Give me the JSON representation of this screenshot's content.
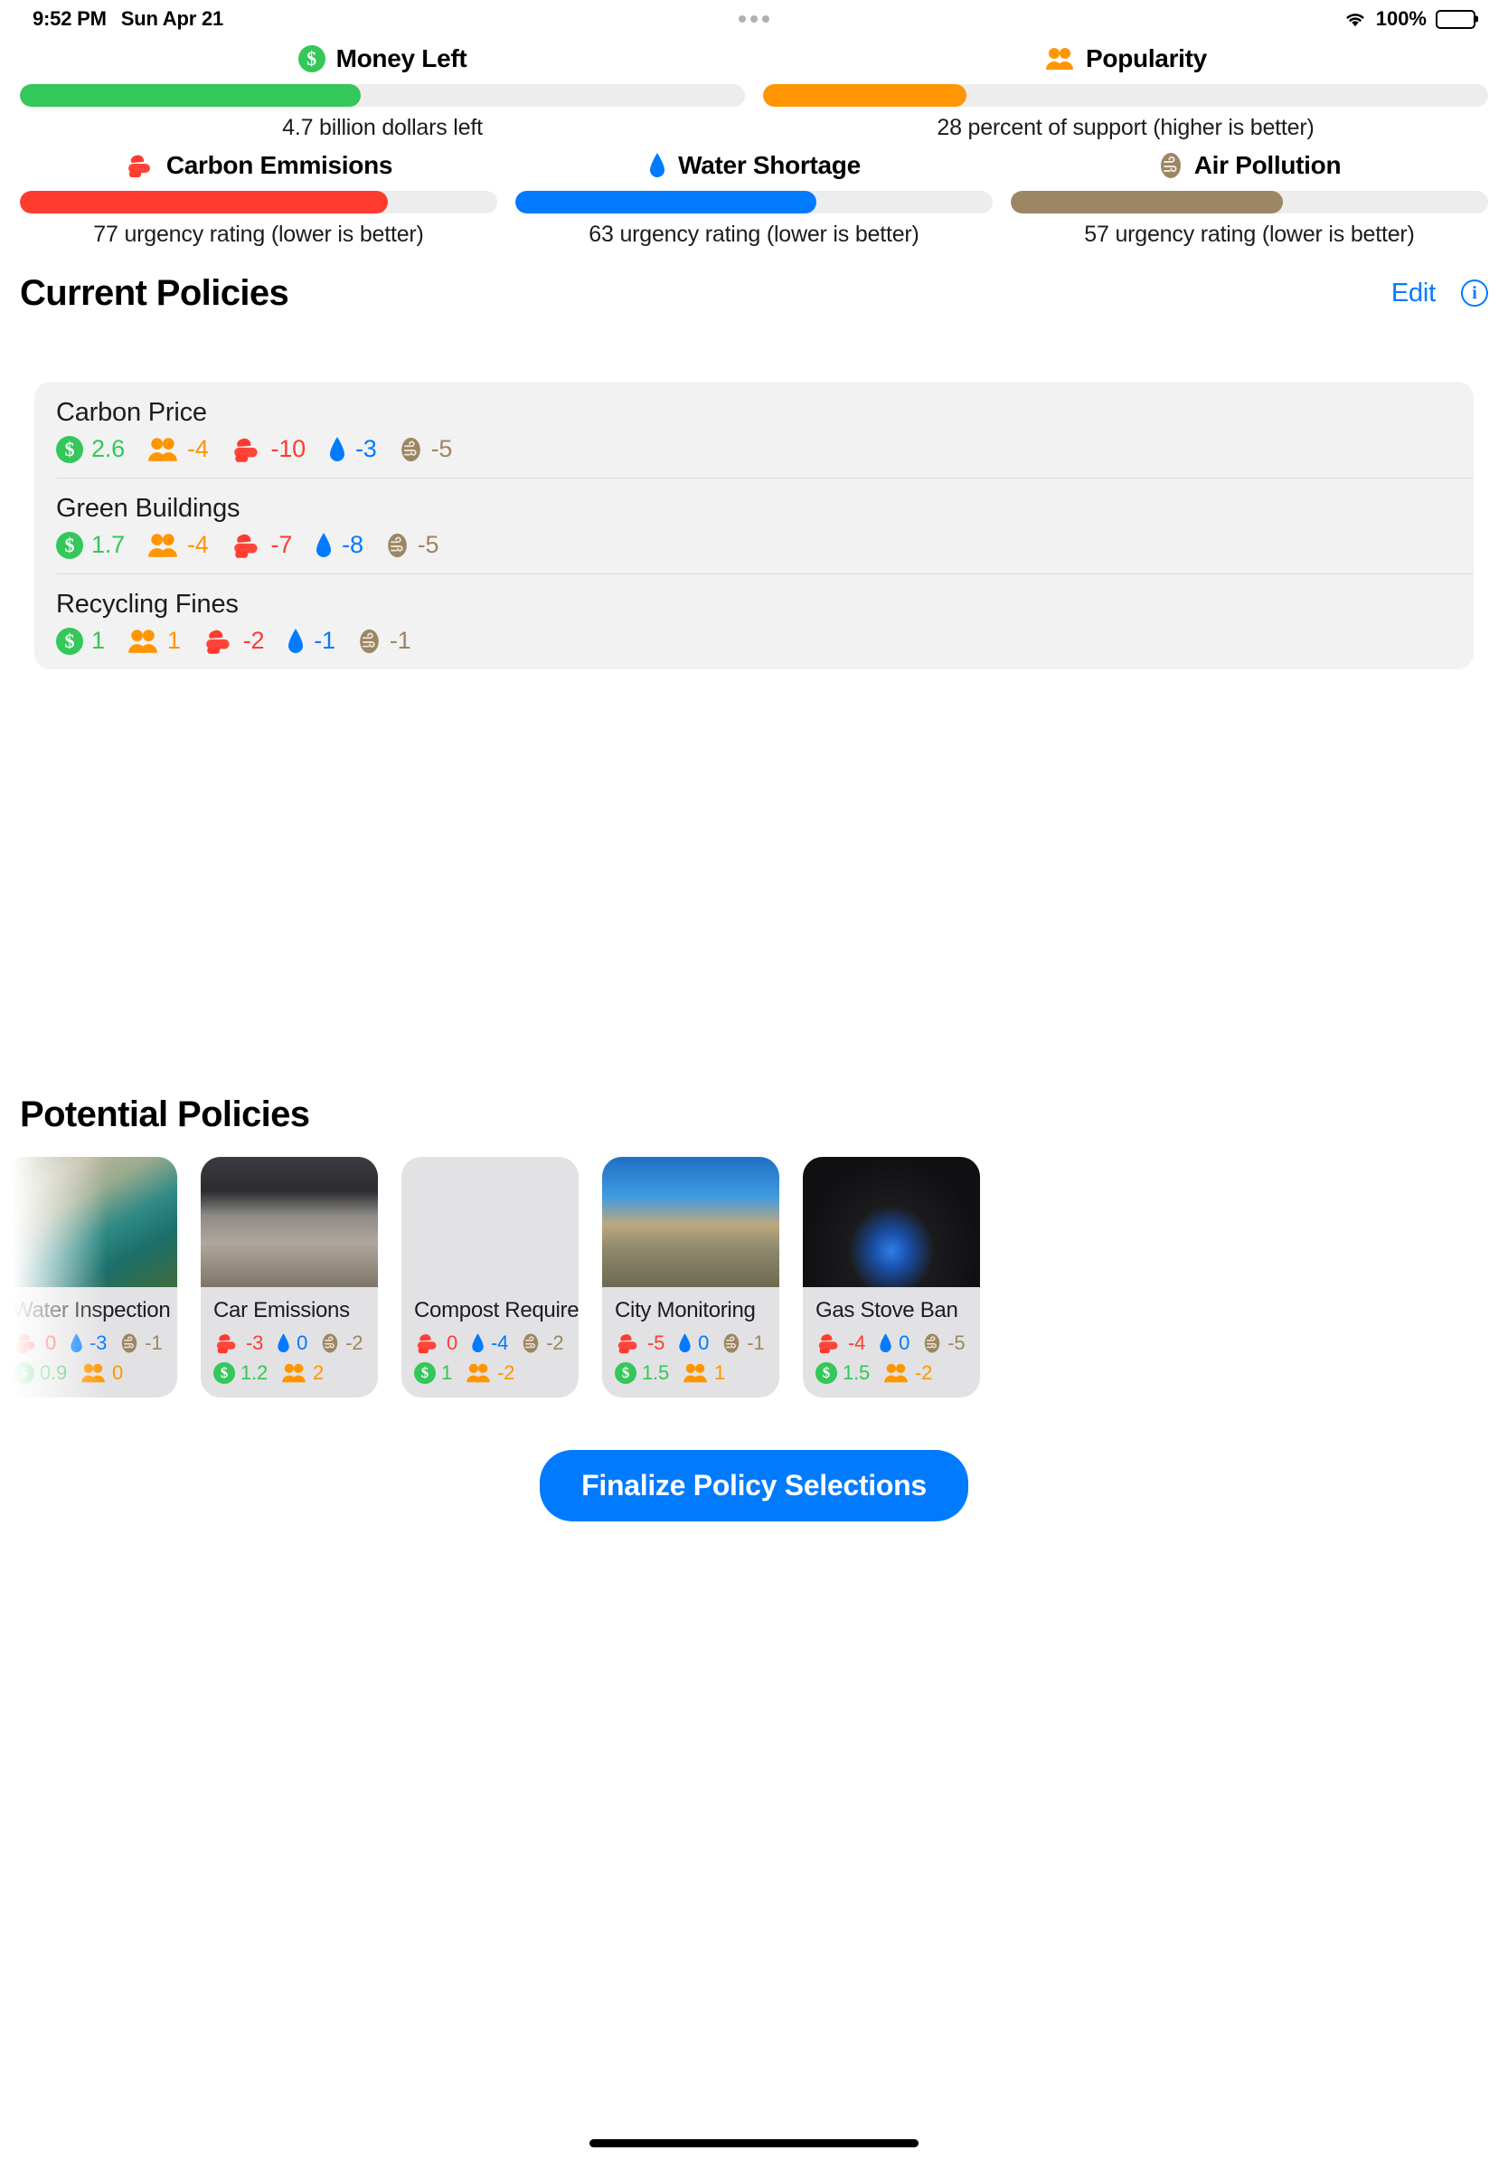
{
  "status_bar": {
    "time": "9:52 PM",
    "date": "Sun Apr 21",
    "battery_percent": "100%",
    "wifi_icon": "wifi-icon",
    "battery_icon": "battery-icon"
  },
  "meters": {
    "row1": [
      {
        "label": "Money Left",
        "icon": "money-icon",
        "color": "#34c759",
        "track_color": "#ededed",
        "percent": 47,
        "caption": "4.7 billion dollars left"
      },
      {
        "label": "Popularity",
        "icon": "people-icon",
        "color": "#ff9500",
        "track_color": "#ededed",
        "percent": 28,
        "caption": "28 percent of support (higher is better)"
      }
    ],
    "row2": [
      {
        "label": "Carbon Emmisions",
        "icon": "carbon-cloud-icon",
        "color": "#ff3b30",
        "track_color": "#ededed",
        "percent": 77,
        "caption": "77 urgency rating (lower is better)"
      },
      {
        "label": "Water Shortage",
        "icon": "water-drop-icon",
        "color": "#007aff",
        "track_color": "#ededed",
        "percent": 63,
        "caption": "63 urgency rating (lower is better)"
      },
      {
        "label": "Air Pollution",
        "icon": "air-wind-icon",
        "color": "#9c8663",
        "track_color": "#ededed",
        "percent": 57,
        "caption": "57 urgency rating (lower is better)"
      }
    ]
  },
  "current_policies_section": {
    "title": "Current Policies",
    "edit_label": "Edit",
    "info_label": "i",
    "policies": [
      {
        "name": "Carbon Price",
        "stats": [
          {
            "icon": "money-icon",
            "value": "2.6",
            "color": "#34c759"
          },
          {
            "icon": "people-icon",
            "value": "-4",
            "color": "#ff9500"
          },
          {
            "icon": "carbon-cloud-icon",
            "value": "-10",
            "color": "#ff3b30"
          },
          {
            "icon": "water-drop-icon",
            "value": "-3",
            "color": "#007aff"
          },
          {
            "icon": "air-wind-icon",
            "value": "-5",
            "color": "#9c8663"
          }
        ]
      },
      {
        "name": "Green Buildings",
        "stats": [
          {
            "icon": "money-icon",
            "value": "1.7",
            "color": "#34c759"
          },
          {
            "icon": "people-icon",
            "value": "-4",
            "color": "#ff9500"
          },
          {
            "icon": "carbon-cloud-icon",
            "value": "-7",
            "color": "#ff3b30"
          },
          {
            "icon": "water-drop-icon",
            "value": "-8",
            "color": "#007aff"
          },
          {
            "icon": "air-wind-icon",
            "value": "-5",
            "color": "#9c8663"
          }
        ]
      },
      {
        "name": "Recycling Fines",
        "stats": [
          {
            "icon": "money-icon",
            "value": "1",
            "color": "#34c759"
          },
          {
            "icon": "people-icon",
            "value": "1",
            "color": "#ff9500"
          },
          {
            "icon": "carbon-cloud-icon",
            "value": "-2",
            "color": "#ff3b30"
          },
          {
            "icon": "water-drop-icon",
            "value": "-1",
            "color": "#007aff"
          },
          {
            "icon": "air-wind-icon",
            "value": "-1",
            "color": "#9c8663"
          }
        ]
      }
    ]
  },
  "potential_policies_section": {
    "title": "Potential Policies",
    "cards": [
      {
        "name": "Water Inspection",
        "image": "aerial-coastal-city-photo",
        "row1": [
          {
            "icon": "carbon-cloud-icon",
            "value": "0",
            "color": "#ff3b30"
          },
          {
            "icon": "water-drop-icon",
            "value": "-3",
            "color": "#007aff"
          },
          {
            "icon": "air-wind-icon",
            "value": "-1",
            "color": "#9c8663"
          }
        ],
        "row2": [
          {
            "icon": "money-icon",
            "value": "0.9",
            "color": "#34c759"
          },
          {
            "icon": "people-icon",
            "value": "0",
            "color": "#ff9500"
          }
        ]
      },
      {
        "name": "Car Emissions",
        "image": "car-exhaust-pipe-photo",
        "row1": [
          {
            "icon": "carbon-cloud-icon",
            "value": "-3",
            "color": "#ff3b30"
          },
          {
            "icon": "water-drop-icon",
            "value": "0",
            "color": "#007aff"
          },
          {
            "icon": "air-wind-icon",
            "value": "-2",
            "color": "#9c8663"
          }
        ],
        "row2": [
          {
            "icon": "money-icon",
            "value": "1.2",
            "color": "#34c759"
          },
          {
            "icon": "people-icon",
            "value": "2",
            "color": "#ff9500"
          }
        ]
      },
      {
        "name": "Compost Required",
        "image": "compost-bin-photo",
        "row1": [
          {
            "icon": "carbon-cloud-icon",
            "value": "0",
            "color": "#ff3b30"
          },
          {
            "icon": "water-drop-icon",
            "value": "-4",
            "color": "#007aff"
          },
          {
            "icon": "air-wind-icon",
            "value": "-2",
            "color": "#9c8663"
          }
        ],
        "row2": [
          {
            "icon": "money-icon",
            "value": "1",
            "color": "#34c759"
          },
          {
            "icon": "people-icon",
            "value": "-2",
            "color": "#ff9500"
          }
        ]
      },
      {
        "name": "City Monitoring",
        "image": "park-rangers-desert-photo",
        "row1": [
          {
            "icon": "carbon-cloud-icon",
            "value": "-5",
            "color": "#ff3b30"
          },
          {
            "icon": "water-drop-icon",
            "value": "0",
            "color": "#007aff"
          },
          {
            "icon": "air-wind-icon",
            "value": "-1",
            "color": "#9c8663"
          }
        ],
        "row2": [
          {
            "icon": "money-icon",
            "value": "1.5",
            "color": "#34c759"
          },
          {
            "icon": "people-icon",
            "value": "1",
            "color": "#ff9500"
          }
        ]
      },
      {
        "name": "Gas Stove Ban",
        "image": "gas-stove-flame-photo",
        "row1": [
          {
            "icon": "carbon-cloud-icon",
            "value": "-4",
            "color": "#ff3b30"
          },
          {
            "icon": "water-drop-icon",
            "value": "0",
            "color": "#007aff"
          },
          {
            "icon": "air-wind-icon",
            "value": "-5",
            "color": "#9c8663"
          }
        ],
        "row2": [
          {
            "icon": "money-icon",
            "value": "1.5",
            "color": "#34c759"
          },
          {
            "icon": "people-icon",
            "value": "-2",
            "color": "#ff9500"
          }
        ]
      }
    ]
  },
  "footer": {
    "finalize_label": "Finalize Policy Selections"
  }
}
